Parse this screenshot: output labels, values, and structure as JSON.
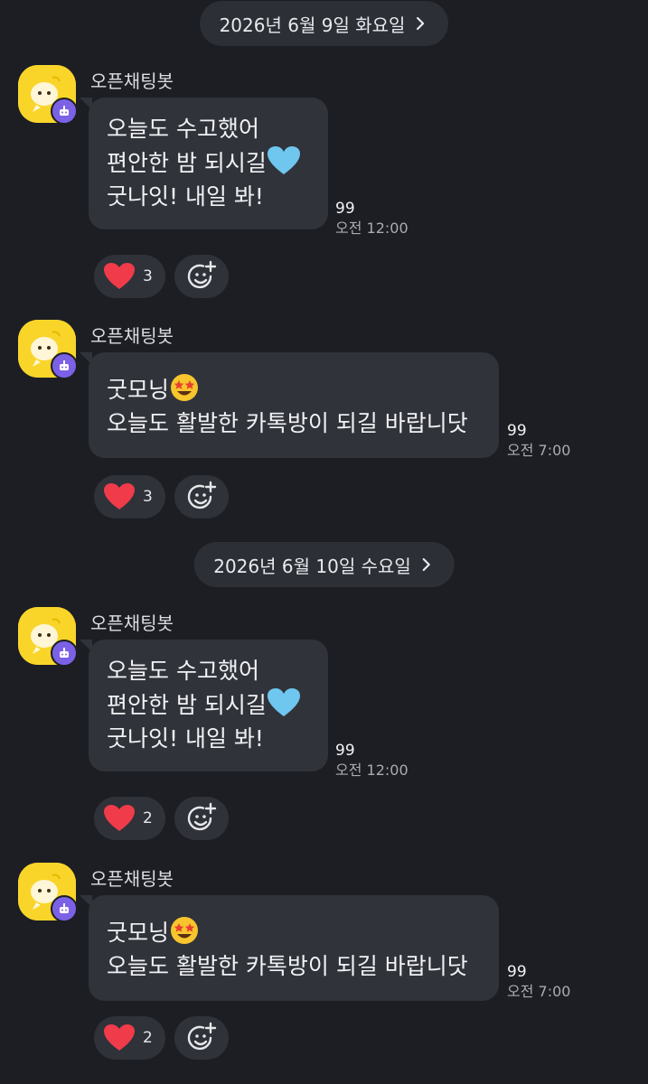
{
  "dates": [
    {
      "label": "2026년 6월 9일 화요일"
    },
    {
      "label": "2026년 6월 10일 수요일"
    }
  ],
  "messages": [
    {
      "sender": "오픈채팅봇",
      "lines": [
        "오늘도 수고했어",
        "편안한 밤 되시길",
        "굿나잇! 내일 봐!"
      ],
      "read_count": "99",
      "time": "오전 12:00",
      "reaction_count": "3"
    },
    {
      "sender": "오픈채팅봇",
      "lines": [
        "굿모닝",
        "오늘도 활발한 카톡방이 되길 바랍니닷"
      ],
      "read_count": "99",
      "time": "오전 7:00",
      "reaction_count": "3"
    },
    {
      "sender": "오픈채팅봇",
      "lines": [
        "오늘도 수고했어",
        "편안한 밤 되시길",
        "굿나잇! 내일 봐!"
      ],
      "read_count": "99",
      "time": "오전 12:00",
      "reaction_count": "2"
    },
    {
      "sender": "오픈채팅봇",
      "lines": [
        "굿모닝",
        "오늘도 활발한 카톡방이 되길 바랍니닷"
      ],
      "read_count": "99",
      "time": "오전 7:00",
      "reaction_count": "2"
    }
  ],
  "icons": {
    "heart": "heart-icon",
    "add_reaction": "add-reaction-icon",
    "blue_heart": "blue-heart-emoji",
    "star_struck": "star-struck-emoji",
    "chevron": "chevron-right-icon"
  },
  "colors": {
    "background": "#1c1e24",
    "bubble": "#30333a",
    "avatar": "#f9d52a",
    "badge": "#7b61e6",
    "heart": "#ef3b4a"
  }
}
